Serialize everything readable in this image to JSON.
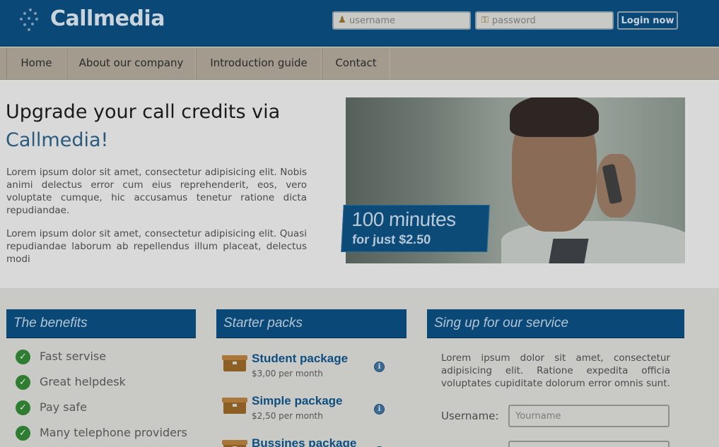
{
  "header": {
    "logo_text": "Callmedia",
    "username_placeholder": "username",
    "password_placeholder": "password",
    "login_label": "Login now"
  },
  "nav": {
    "items": [
      {
        "label": "Home"
      },
      {
        "label": "About our company"
      },
      {
        "label": "Introduction guide"
      },
      {
        "label": "Contact"
      }
    ]
  },
  "hero": {
    "title_line1": "Upgrade your call credits via",
    "title_line2": "Callmedia!",
    "paragraph1": "Lorem ipsum dolor sit amet, consectetur adipisicing elit. Nobis animi delectus error cum eius reprehenderit, eos, vero voluptate cumque, hic accusamus tenetur ratione dicta repudiandae.",
    "paragraph2": "Lorem ipsum dolor sit amet, consectetur adipisicing elit. Quasi repudiandae laborum ab repellendus illum placeat, delectus modi",
    "promo_big": "100 minutes",
    "promo_small": "for just $2.50"
  },
  "benefits": {
    "heading": "The benefits",
    "items": [
      "Fast servise",
      "Great helpdesk",
      "Pay safe",
      "Many telephone providers"
    ]
  },
  "starter": {
    "heading": "Starter packs",
    "packages": [
      {
        "name": "Student package",
        "price": "$3,00 per month"
      },
      {
        "name": "Simple package",
        "price": "$2,50 per month"
      },
      {
        "name": "Bussines package",
        "price": ""
      }
    ]
  },
  "signup": {
    "heading": "Sing up for our service",
    "text": "Lorem ipsum dolor sit amet, consectetur adipisicing elit. Ratione expedita officia voluptates cupiditate dolorum error omnis sunt.",
    "username_label": "Username:",
    "username_placeholder": "Yourname"
  }
}
